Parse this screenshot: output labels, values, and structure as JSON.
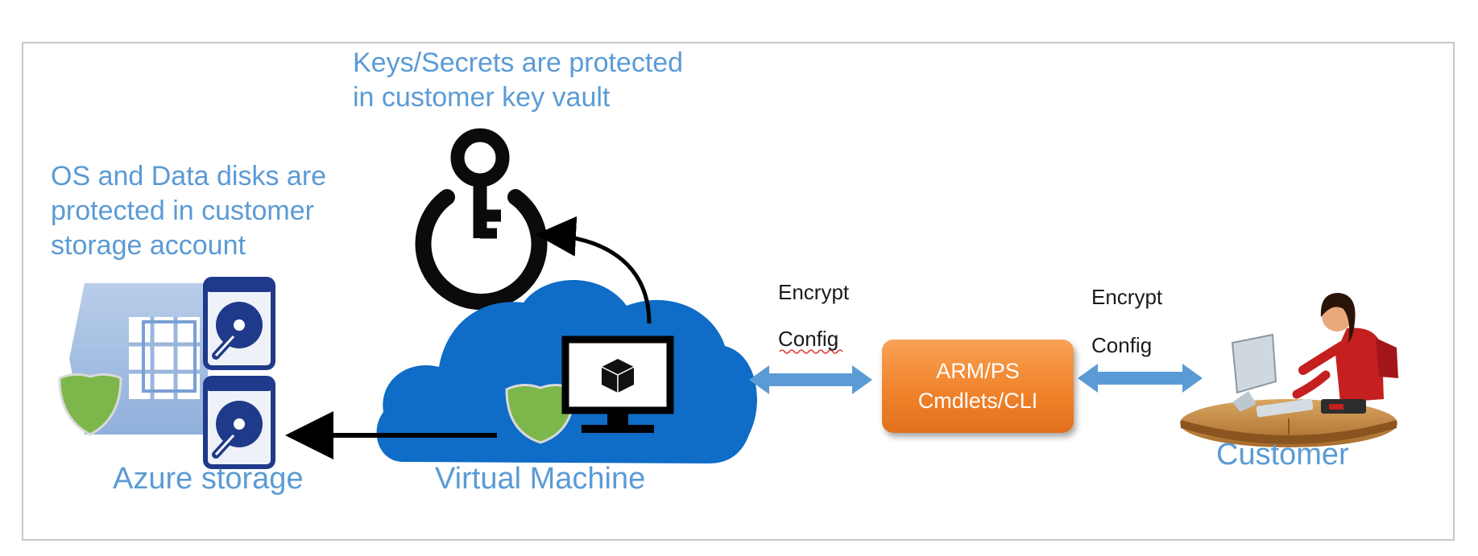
{
  "notes": {
    "key_vault": [
      "Keys/Secrets are protected",
      "in customer key vault"
    ],
    "storage": [
      "OS and Data disks are",
      "protected in customer",
      "storage account"
    ]
  },
  "labels": {
    "azure_storage": "Azure storage",
    "virtual_machine": "Virtual Machine",
    "customer": "Customer"
  },
  "connectors": {
    "vm_to_arm": {
      "line1": "Encrypt",
      "line2": "Config"
    },
    "arm_to_customer": {
      "line1": "Encrypt",
      "line2": "Config"
    }
  },
  "arm_box": {
    "line1": "ARM/PS",
    "line2": "Cmdlets/CLI"
  },
  "colors": {
    "label_blue": "#5b9bd5",
    "cloud_blue": "#0f6cc7",
    "arrow_blue": "#5b9bd5",
    "shield_green": "#7db64a",
    "arm_orange": "#f0832c",
    "disk_navy": "#1f3a8a"
  },
  "icons": [
    "key-vault-icon",
    "storage-account-icon",
    "disk-icon",
    "shield-icon",
    "cloud-icon",
    "monitor-icon",
    "cube-icon",
    "customer-person-icon"
  ]
}
